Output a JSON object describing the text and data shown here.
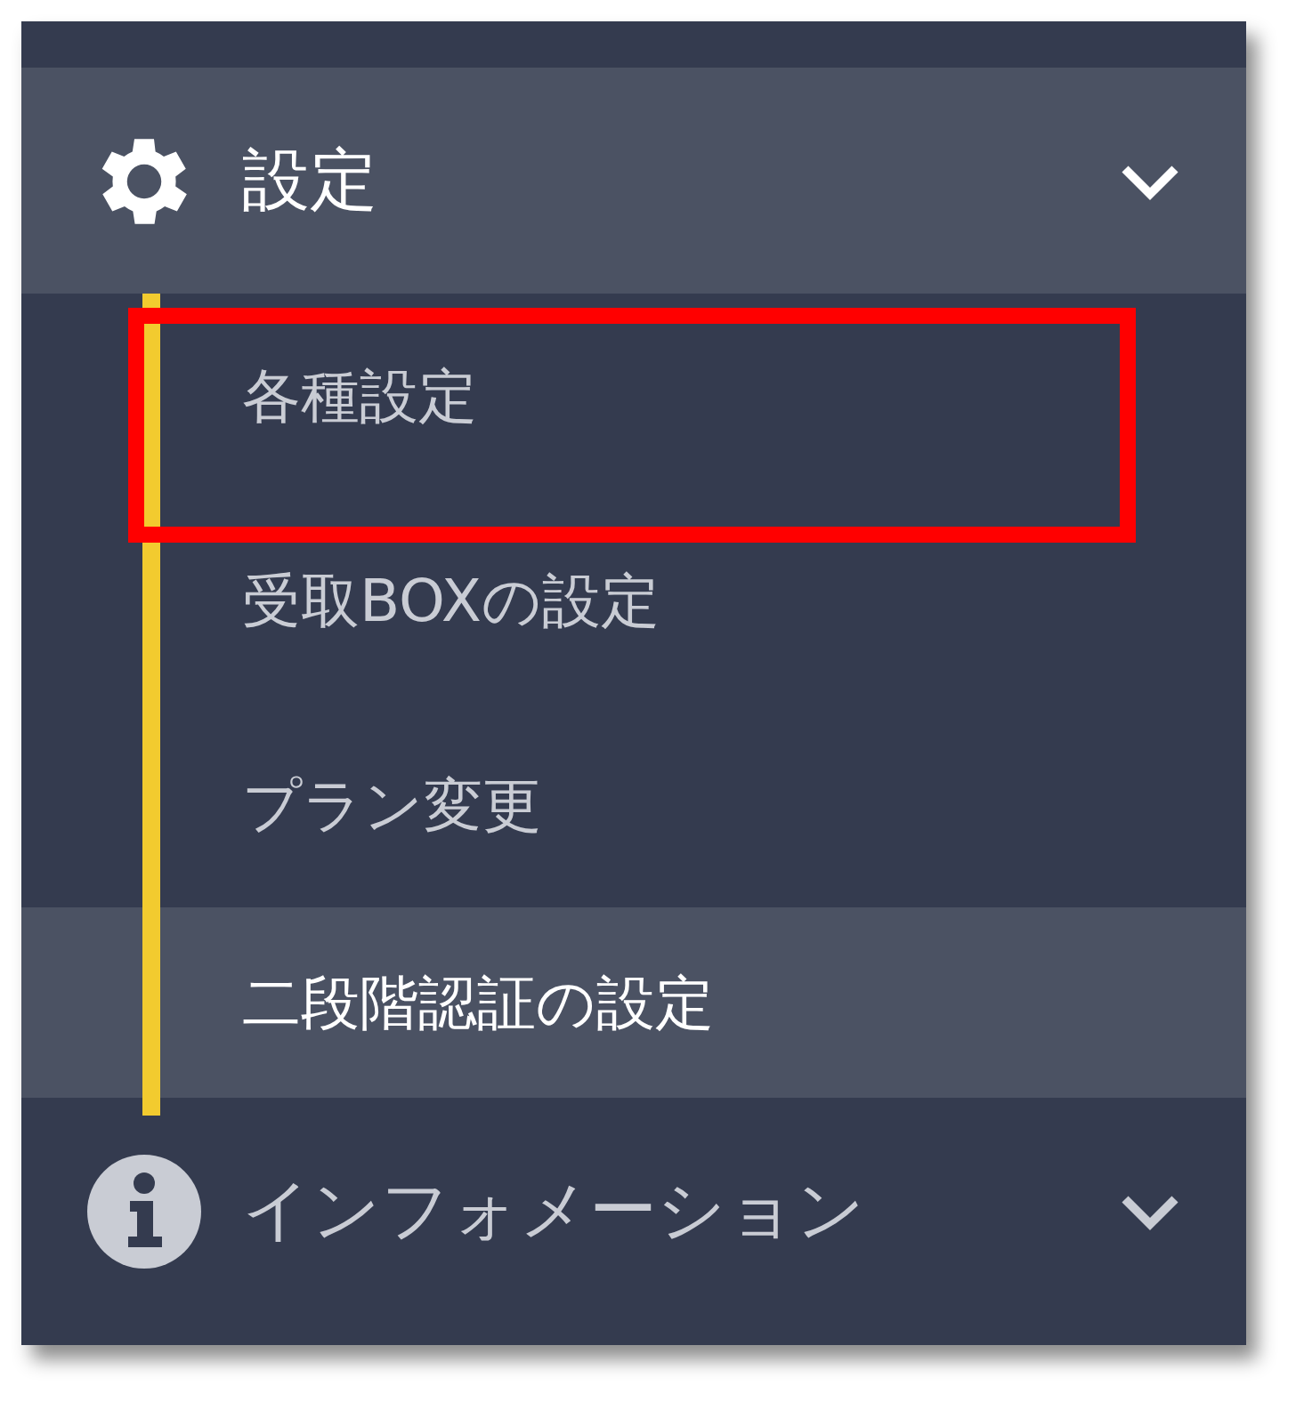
{
  "menu": [
    {
      "kind": "settings",
      "label": "設定",
      "expanded": true,
      "children": [
        {
          "label": "各種設定",
          "selected": false,
          "annotated": true
        },
        {
          "label": "受取BOXの設定",
          "selected": false,
          "annotated": false
        },
        {
          "label": "プラン変更",
          "selected": false,
          "annotated": false
        },
        {
          "label": "二段階認証の設定",
          "selected": true,
          "annotated": false
        }
      ]
    },
    {
      "kind": "info",
      "label": "インフォメーション",
      "expanded": false
    }
  ]
}
